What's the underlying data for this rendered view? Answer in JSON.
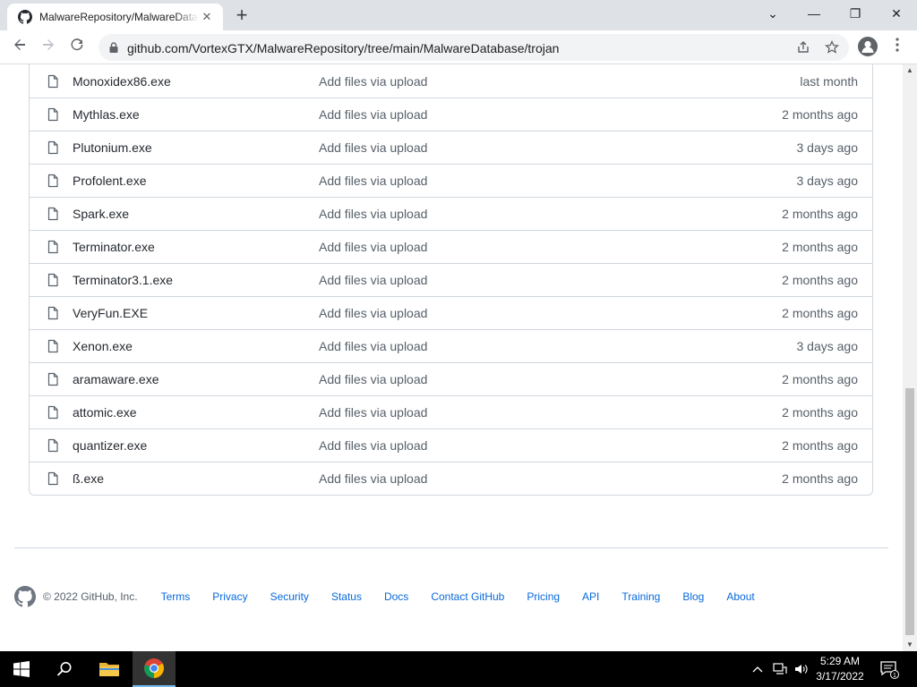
{
  "browser": {
    "tab_title": "MalwareRepository/MalwareDatabase",
    "tab_close": "✕",
    "new_tab": "+",
    "url": "github.com/VortexGTX/MalwareRepository/tree/main/MalwareDatabase/trojan",
    "window_controls": {
      "minimize": "—",
      "maximize": "❐",
      "close": "✕",
      "tab_search": "⌄"
    }
  },
  "files": [
    {
      "name": "Monoxidex86.exe",
      "message": "Add files via upload",
      "age": "last month"
    },
    {
      "name": "Mythlas.exe",
      "message": "Add files via upload",
      "age": "2 months ago"
    },
    {
      "name": "Plutonium.exe",
      "message": "Add files via upload",
      "age": "3 days ago"
    },
    {
      "name": "Profolent.exe",
      "message": "Add files via upload",
      "age": "3 days ago"
    },
    {
      "name": "Spark.exe",
      "message": "Add files via upload",
      "age": "2 months ago"
    },
    {
      "name": "Terminator.exe",
      "message": "Add files via upload",
      "age": "2 months ago"
    },
    {
      "name": "Terminator3.1.exe",
      "message": "Add files via upload",
      "age": "2 months ago"
    },
    {
      "name": "VeryFun.EXE",
      "message": "Add files via upload",
      "age": "2 months ago"
    },
    {
      "name": "Xenon.exe",
      "message": "Add files via upload",
      "age": "3 days ago"
    },
    {
      "name": "aramaware.exe",
      "message": "Add files via upload",
      "age": "2 months ago"
    },
    {
      "name": "attomic.exe",
      "message": "Add files via upload",
      "age": "2 months ago"
    },
    {
      "name": "quantizer.exe",
      "message": "Add files via upload",
      "age": "2 months ago"
    },
    {
      "name": "ß.exe",
      "message": "Add files via upload",
      "age": "2 months ago"
    }
  ],
  "footer": {
    "copyright": "© 2022 GitHub, Inc.",
    "links": [
      "Terms",
      "Privacy",
      "Security",
      "Status",
      "Docs",
      "Contact GitHub",
      "Pricing",
      "API",
      "Training",
      "Blog",
      "About"
    ]
  },
  "taskbar": {
    "time": "5:29 AM",
    "date": "3/17/2022",
    "notification_count": "1"
  },
  "colors": {
    "link": "#0969da",
    "muted": "#57606a",
    "border": "#d0d7de"
  }
}
